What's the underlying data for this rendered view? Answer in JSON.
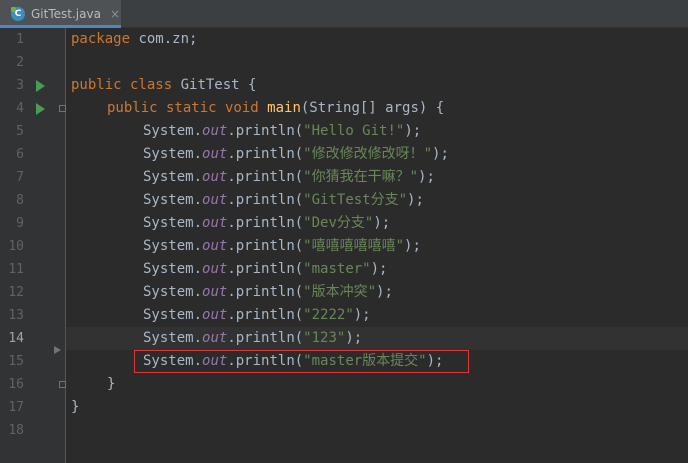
{
  "tab": {
    "filename": "GitTest.java",
    "close": "×"
  },
  "gutter": {
    "line_numbers": [
      "1",
      "2",
      "3",
      "4",
      "5",
      "6",
      "7",
      "8",
      "9",
      "10",
      "11",
      "12",
      "13",
      "14",
      "15",
      "16",
      "17",
      "18"
    ],
    "current_line": "14"
  },
  "code": {
    "line1": {
      "kw": "package",
      "rest": " com.zn;"
    },
    "line3": {
      "kw": "public class",
      "rest": " GitTest {"
    },
    "line4": {
      "kw": "public static void",
      "method": "main",
      "rest": "(String[] args) {"
    },
    "prints": [
      {
        "obj": "System.",
        "fld": "out",
        "call": ".println(",
        "str": "\"Hello Git!\"",
        "end": ");"
      },
      {
        "obj": "System.",
        "fld": "out",
        "call": ".println(",
        "str": "\"修改修改修改呀！\"",
        "end": ");"
      },
      {
        "obj": "System.",
        "fld": "out",
        "call": ".println(",
        "str": "\"你猜我在干嘛？\"",
        "end": ");"
      },
      {
        "obj": "System.",
        "fld": "out",
        "call": ".println(",
        "str": "\"GitTest分支\"",
        "end": ");"
      },
      {
        "obj": "System.",
        "fld": "out",
        "call": ".println(",
        "str": "\"Dev分支\"",
        "end": ");"
      },
      {
        "obj": "System.",
        "fld": "out",
        "call": ".println(",
        "str": "\"嘻嘻嘻嘻嘻嘻\"",
        "end": ");"
      },
      {
        "obj": "System.",
        "fld": "out",
        "call": ".println(",
        "str": "\"master\"",
        "end": ");"
      },
      {
        "obj": "System.",
        "fld": "out",
        "call": ".println(",
        "str": "\"版本冲突\"",
        "end": ");"
      },
      {
        "obj": "System.",
        "fld": "out",
        "call": ".println(",
        "str": "\"2222\"",
        "end": ");"
      },
      {
        "obj": "System.",
        "fld": "out",
        "call": ".println(",
        "str": "\"123\"",
        "end": ");"
      },
      {
        "obj": "System.",
        "fld": "out",
        "call": ".println(",
        "str": "\"master版本提交\"",
        "end": ");"
      }
    ],
    "line16": "}",
    "line17": "}"
  },
  "colors": {
    "background": "#2b2b2b",
    "gutter": "#313335",
    "keyword": "#cc7832",
    "string": "#6a8759",
    "field": "#9876aa",
    "method": "#ffc66d",
    "default_text": "#a9b7c6",
    "highlight_box": "#e0363b",
    "run_arrow": "#499c54"
  }
}
